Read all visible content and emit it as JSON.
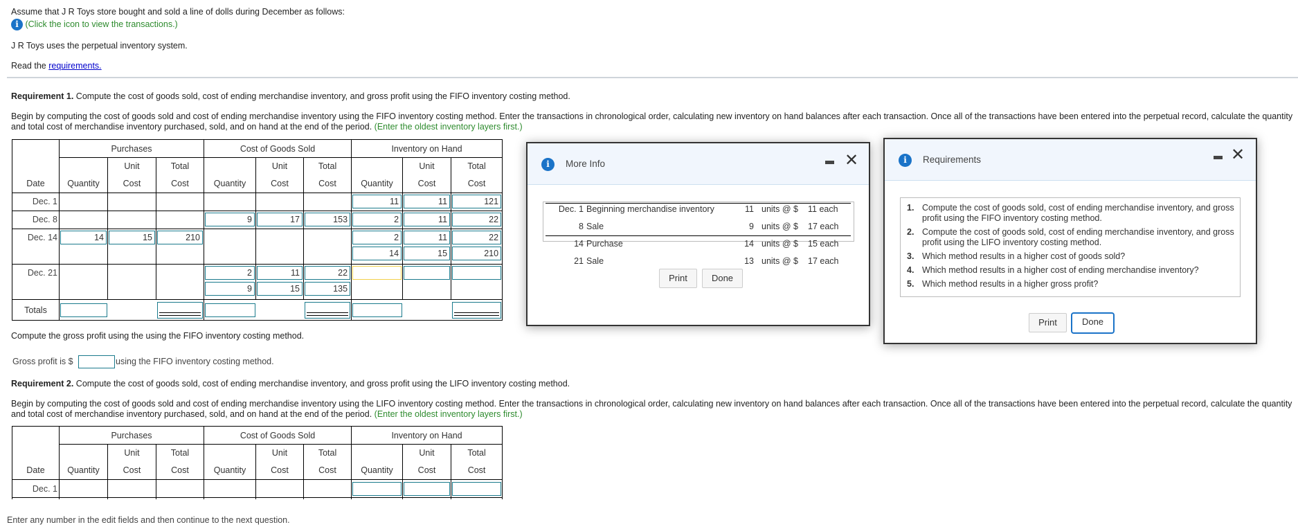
{
  "intro": {
    "line1": "Assume that J R Toys store bought and sold a line of dolls during December as follows:",
    "click_icon_text": "(Click the icon to view the transactions.)",
    "system_text": "J R Toys uses the perpetual inventory system.",
    "read_prefix": "Read the ",
    "requirements_link": "requirements."
  },
  "req1": {
    "label": "Requirement 1.",
    "text": " Compute the cost of goods sold, cost of ending merchandise inventory, and gross profit using the FIFO inventory costing method.",
    "instructions": "Begin by computing the cost of goods sold and cost of ending merchandise inventory using the FIFO inventory costing method. Enter the transactions in chronological order, calculating new inventory on hand balances after each transaction. Once all of the transactions have been entered into the perpetual record, calculate the quantity and total cost of merchandise inventory purchased, sold, and on hand at the end of the period. ",
    "hint": "(Enter the oldest inventory layers first.)",
    "gross_profit_prompt": "Compute the gross profit using the using the FIFO inventory costing method.",
    "gross_profit_prefix": "Gross profit is $",
    "gross_profit_value": "",
    "gross_profit_suffix": "using the FIFO inventory costing method."
  },
  "table_headers": {
    "groups": [
      "Purchases",
      "Cost of Goods Sold",
      "Inventory on Hand"
    ],
    "date": "Date",
    "quantity": "Quantity",
    "unit_top": "Unit",
    "total_top": "Total",
    "cost": "Cost",
    "totals": "Totals"
  },
  "fifo_table": {
    "rows": [
      {
        "date": "Dec. 1",
        "purchases": [],
        "cogs": [],
        "inventory": [
          {
            "qty": "11",
            "unit": "11",
            "total": "121"
          }
        ]
      },
      {
        "date": "Dec. 8",
        "purchases": [],
        "cogs": [
          {
            "qty": "9",
            "unit": "17",
            "total": "153"
          }
        ],
        "inventory": [
          {
            "qty": "2",
            "unit": "11",
            "total": "22"
          }
        ]
      },
      {
        "date": "Dec. 14",
        "purchases": [
          {
            "qty": "14",
            "unit": "15",
            "total": "210"
          }
        ],
        "cogs": [],
        "inventory": [
          {
            "qty": "2",
            "unit": "11",
            "total": "22"
          },
          {
            "qty": "14",
            "unit": "15",
            "total": "210"
          }
        ]
      },
      {
        "date": "Dec. 21",
        "purchases": [],
        "cogs": [
          {
            "qty": "2",
            "unit": "11",
            "total": "22"
          },
          {
            "qty": "9",
            "unit": "15",
            "total": "135"
          }
        ],
        "inventory": [
          {
            "qty": "",
            "unit": "",
            "total": ""
          }
        ]
      }
    ],
    "totals": {
      "purchases_qty": "",
      "purchases_total": "",
      "cogs_qty": "",
      "cogs_total": "",
      "inventory_qty": "",
      "inventory_total": ""
    }
  },
  "req2": {
    "label": "Requirement 2.",
    "text": " Compute the cost of goods sold, cost of ending merchandise inventory, and gross profit using the LIFO inventory costing method.",
    "instructions": "Begin by computing the cost of goods sold and cost of ending merchandise inventory using the LIFO inventory costing method. Enter the transactions in chronological order, calculating new inventory on hand balances after each transaction. Once all of the transactions have been entered into the perpetual record, calculate the quantity and total cost of merchandise inventory purchased, sold, and on hand at the end of the period. ",
    "hint": "(Enter the oldest inventory layers first.)"
  },
  "lifo_table": {
    "rows": [
      {
        "date": "Dec. 1",
        "inventory": [
          {
            "qty": "",
            "unit": "",
            "total": ""
          }
        ]
      }
    ]
  },
  "footer_note": "Enter any number in the edit fields and then continue to the next question.",
  "more_info_modal": {
    "title": "More Info",
    "icon": "info-icon",
    "transactions": [
      {
        "date": "Dec. 1",
        "desc": "Beginning merchandise inventory",
        "units": "11",
        "units_label": "units @ $",
        "price": "11",
        "each": "each"
      },
      {
        "date": "8",
        "desc": "Sale",
        "units": "9",
        "units_label": "units @ $",
        "price": "17",
        "each": "each"
      },
      {
        "date": "14",
        "desc": "Purchase",
        "units": "14",
        "units_label": "units @ $",
        "price": "15",
        "each": "each"
      },
      {
        "date": "21",
        "desc": "Sale",
        "units": "13",
        "units_label": "units @ $",
        "price": "17",
        "each": "each"
      }
    ],
    "print_label": "Print",
    "done_label": "Done"
  },
  "requirements_modal": {
    "title": "Requirements",
    "icon": "info-icon",
    "items": [
      {
        "num": "1.",
        "text": "Compute the cost of goods sold, cost of ending merchandise inventory, and gross profit using the FIFO inventory costing method."
      },
      {
        "num": "2.",
        "text": "Compute the cost of goods sold, cost of ending merchandise inventory, and gross profit using the LIFO inventory costing method."
      },
      {
        "num": "3.",
        "text": "Which method results in a higher cost of goods sold?"
      },
      {
        "num": "4.",
        "text": "Which method results in a higher cost of ending merchandise inventory?"
      },
      {
        "num": "5.",
        "text": "Which method results in a higher gross profit?"
      }
    ],
    "print_label": "Print",
    "done_label": "Done"
  },
  "colors": {
    "accent_blue": "#1a73c8",
    "hint_green": "#2e8b2e",
    "input_border": "#1a7a8c",
    "active_input_border": "#f2d04a",
    "modal_header_bg": "#f1f6fd"
  }
}
